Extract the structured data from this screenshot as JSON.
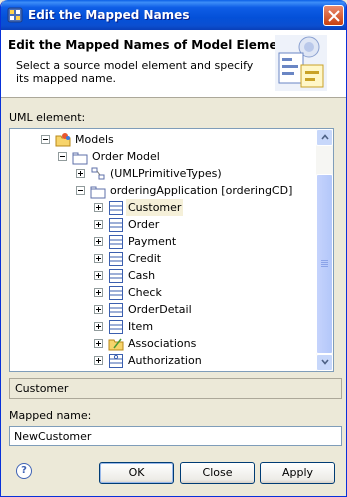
{
  "window": {
    "title": "Edit the Mapped Names",
    "icons": {
      "app": "rsa-icon",
      "close": "close-icon"
    }
  },
  "banner": {
    "title": "Edit the Mapped Names of Model Element",
    "description": "Select a source model element and specify its mapped name.",
    "icon": "wizard-banner-icon"
  },
  "uml_element_label": "UML element:",
  "tree": {
    "nodes": [
      {
        "label": "Models",
        "icon": "models-folder-icon",
        "expanded": true,
        "depth": 0
      },
      {
        "label": "Order Model",
        "icon": "package-icon",
        "expanded": true,
        "depth": 1
      },
      {
        "label": "(UMLPrimitiveTypes)",
        "icon": "primitive-types-icon",
        "expanded": false,
        "depth": 2
      },
      {
        "label": "orderingApplication [orderingCD]",
        "icon": "package-icon",
        "expanded": true,
        "depth": 2
      },
      {
        "label": "Customer",
        "icon": "class-icon",
        "expanded": false,
        "depth": 3,
        "selected": true
      },
      {
        "label": "Order",
        "icon": "class-icon",
        "expanded": false,
        "depth": 3
      },
      {
        "label": "Payment",
        "icon": "class-icon",
        "expanded": false,
        "depth": 3
      },
      {
        "label": "Credit",
        "icon": "class-icon",
        "expanded": false,
        "depth": 3
      },
      {
        "label": "Cash",
        "icon": "class-icon",
        "expanded": false,
        "depth": 3
      },
      {
        "label": "Check",
        "icon": "class-icon",
        "expanded": false,
        "depth": 3
      },
      {
        "label": "OrderDetail",
        "icon": "class-icon",
        "expanded": false,
        "depth": 3
      },
      {
        "label": "Item",
        "icon": "class-icon",
        "expanded": false,
        "depth": 3
      },
      {
        "label": "Associations",
        "icon": "folder-icon",
        "expanded": false,
        "depth": 3
      },
      {
        "label": "Authorization",
        "icon": "interface-icon",
        "expanded": false,
        "depth": 3
      }
    ]
  },
  "selected_element": "Customer",
  "mapped_name_label": "Mapped name:",
  "mapped_name_value": "NewCustomer",
  "buttons": {
    "ok": "OK",
    "close": "Close",
    "apply": "Apply",
    "help": "?"
  },
  "colors": {
    "title_bar": "#0a5fe6",
    "selection_highlight": "#f5f0d9",
    "dialog_bg": "#ece9d8"
  }
}
